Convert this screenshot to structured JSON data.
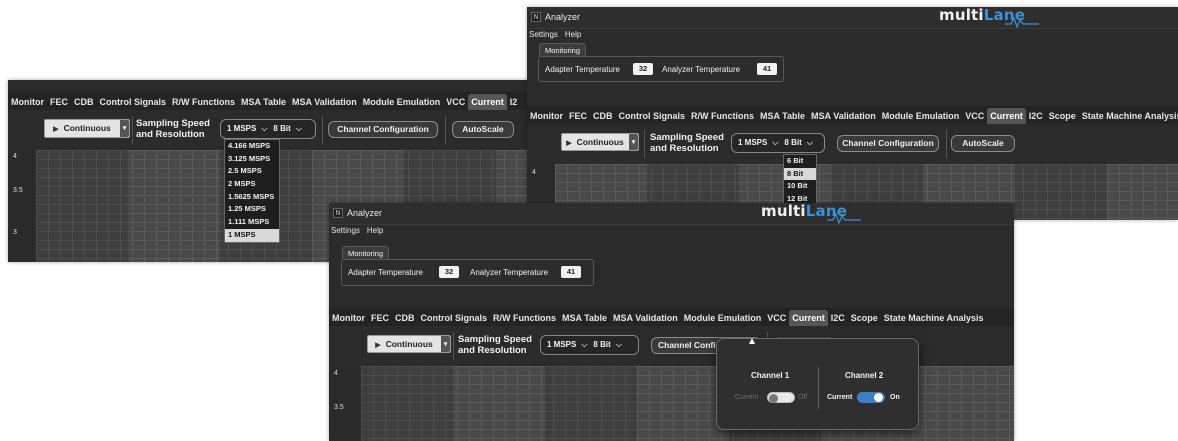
{
  "app": {
    "icon_name": "analyzer-app-icon",
    "icon_glyph": "N",
    "title": "Analyzer",
    "logo_main": "multi",
    "logo_accent": "Lane"
  },
  "menu": {
    "settings": "Settings",
    "help": "Help"
  },
  "monitoring": {
    "label": "Monitoring",
    "adapter_label": "Adapter Temperature",
    "adapter_value": "32",
    "analyzer_label": "Analyzer Temperature",
    "analyzer_value": "41"
  },
  "tabs": [
    "Monitor",
    "FEC",
    "CDB",
    "Control Signals",
    "R/W Functions",
    "MSA Table",
    "MSA Validation",
    "Module Emulation",
    "VCC",
    "Current",
    "I2C",
    "Scope",
    "State Machine Analysis"
  ],
  "tabs_p1": [
    "Monitor",
    "FEC",
    "CDB",
    "Control Signals",
    "R/W Functions",
    "MSA Table",
    "MSA Validation",
    "Module Emulation",
    "VCC",
    "Current",
    "I2"
  ],
  "active_tab": "Current",
  "toolbar": {
    "play_icon": "▶",
    "continuous": "Continuous",
    "dropdown_arrow": "▾",
    "ssr_line1": "Sampling Speed",
    "ssr_line2": "and Resolution",
    "speed": "1 MSPS",
    "chevron": "⌵",
    "bits": "8 Bit",
    "channel_config": "Channel Configuration",
    "channel_config_partial": "Channel Config",
    "channel_config_tail": "ation",
    "autoscale": "AutoScale"
  },
  "plot": {
    "y_ticks_p1": [
      "4",
      "3.5",
      "3"
    ],
    "y_ticks": [
      "4",
      "3.5"
    ]
  },
  "speed_options": [
    "4.166 MSPS",
    "3.125 MSPS",
    "2.5 MSPS",
    "2 MSPS",
    "1.5625 MSPS",
    "1.25 MSPS",
    "1.111 MSPS",
    "1 MSPS"
  ],
  "speed_selected": "1 MSPS",
  "bit_options": [
    "6 Bit",
    "8 Bit",
    "10 Bit",
    "12 Bit"
  ],
  "bit_selected": "8 Bit",
  "channels": {
    "ch1": {
      "title": "Channel 1",
      "left": "Current",
      "right": "Off",
      "state": "off"
    },
    "ch2": {
      "title": "Channel 2",
      "left": "Current",
      "right": "On",
      "state": "on"
    }
  },
  "colors": {
    "accent_blue": "#3d8fd6",
    "switch_on": "#3c7fc6",
    "background": "#2b2b2b"
  }
}
